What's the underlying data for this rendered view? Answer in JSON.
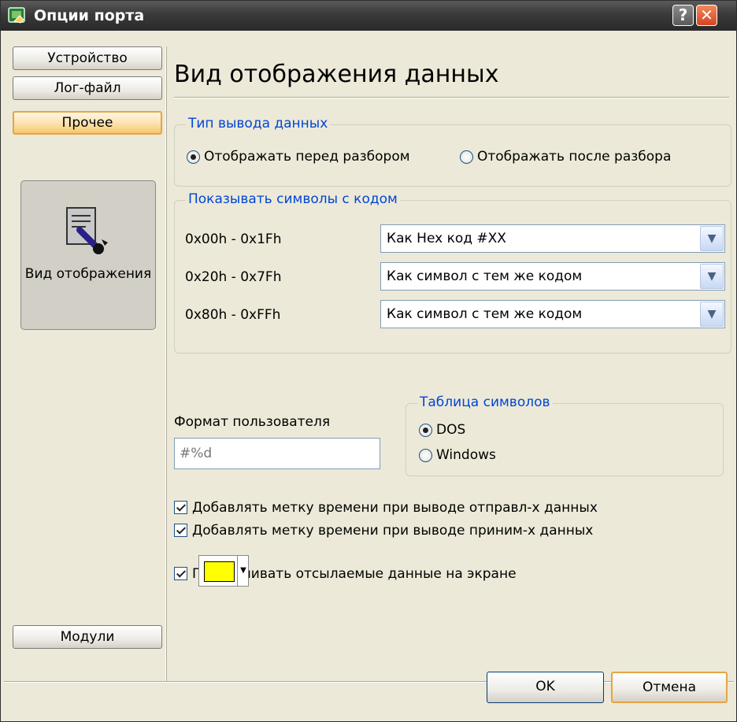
{
  "window": {
    "title": "Опции порта",
    "help_label": "?",
    "close_label": "✕"
  },
  "sidebar": {
    "items": [
      {
        "label": "Устройство"
      },
      {
        "label": "Лог-файл"
      },
      {
        "label": "Прочее",
        "active": true
      }
    ],
    "tile": {
      "label": "Вид отображения",
      "icon": "display-settings-icon"
    },
    "bottom_label": "Модули"
  },
  "main": {
    "heading": "Вид отображения данных",
    "output_type": {
      "legend": "Тип вывода данных",
      "options": [
        {
          "label": "Отображать перед разбором",
          "selected": true
        },
        {
          "label": "Отображать после разбора",
          "selected": false
        }
      ]
    },
    "show_codes": {
      "legend": "Показывать символы с кодом",
      "rows": [
        {
          "range": "0x00h - 0x1Fh",
          "value": "Как Hex код #XX"
        },
        {
          "range": "0x20h - 0x7Fh",
          "value": "Как символ с тем же кодом"
        },
        {
          "range": "0x80h - 0xFFh",
          "value": "Как символ с тем же кодом"
        }
      ]
    },
    "user_format": {
      "label": "Формат пользователя",
      "value": "#%d"
    },
    "charset": {
      "legend": "Таблица символов",
      "options": [
        {
          "label": "DOS",
          "selected": true
        },
        {
          "label": "Windows",
          "selected": false
        }
      ]
    },
    "checkboxes": [
      {
        "label": "Добавлять метку времени при выводе отправл-х данных",
        "checked": true
      },
      {
        "label": "Добавлять метку времени при выводе приним-х данных",
        "checked": true
      },
      {
        "label": "Подсвечивать отсылаемые данные на экране",
        "checked": true
      }
    ],
    "highlight_color": "#ffff00"
  },
  "footer": {
    "ok_label": "OK",
    "cancel_label": "Отмена"
  }
}
